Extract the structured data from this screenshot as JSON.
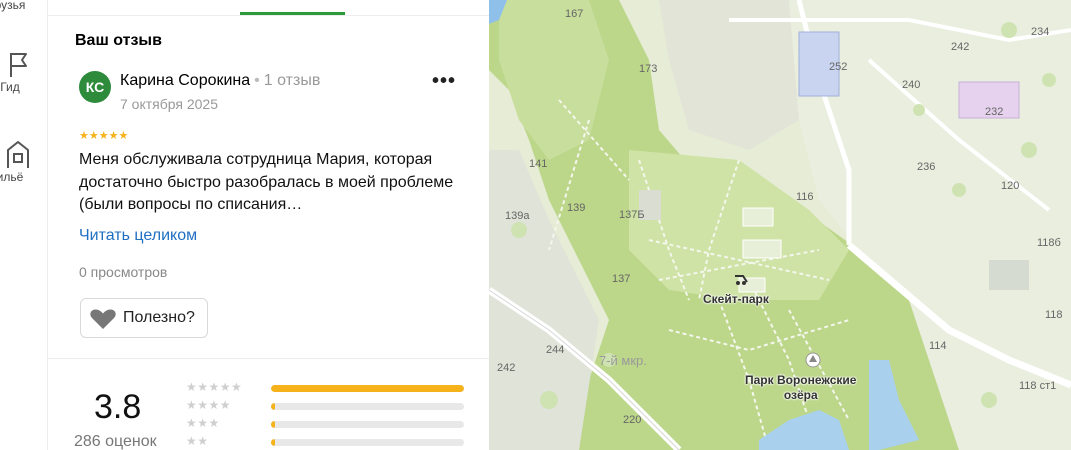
{
  "nav": {
    "items": [
      {
        "label": "рузья"
      },
      {
        "label": "Гид"
      },
      {
        "label": "ильё"
      }
    ]
  },
  "review_section": {
    "title": "Ваш отзыв",
    "avatar_initials": "КС",
    "author": "Карина Сорокина",
    "author_reviews": "1 отзыв",
    "date": "7 октября 2025",
    "more": "•••",
    "rating_stars": "★★★★★",
    "text": "Меня обслуживала сотрудница Мария, которая достаточно быстро разобралась в моей проблеме (были вопросы по списания…",
    "read_more": "Читать целиком",
    "views": "0 просмотров",
    "useful_label": "Полезно?"
  },
  "rating_summary": {
    "score": "3.8",
    "count": "286 оценок",
    "distribution": [
      {
        "stars": "★★★★★",
        "fraction": 1.0
      },
      {
        "stars": "★★★★",
        "fraction": 0.02
      },
      {
        "stars": "★★★",
        "fraction": 0.02
      },
      {
        "stars": "★★",
        "fraction": 0.02
      }
    ]
  },
  "map": {
    "poi": [
      {
        "label": "Скейт-парк"
      },
      {
        "label": "Парк Воронежские\nозёра"
      }
    ],
    "district": "7-й мкр.",
    "house_numbers": [
      "167",
      "173",
      "252",
      "242",
      "234",
      "240",
      "232",
      "141",
      "139",
      "137Б",
      "139а",
      "116",
      "236",
      "120",
      "118б",
      "137",
      "244",
      "242",
      "114",
      "220",
      "118",
      "118 ст1"
    ]
  },
  "colors": {
    "accent_green": "#2b9a3b",
    "link_blue": "#1f6fc2",
    "star_yellow": "#f5b21b"
  }
}
